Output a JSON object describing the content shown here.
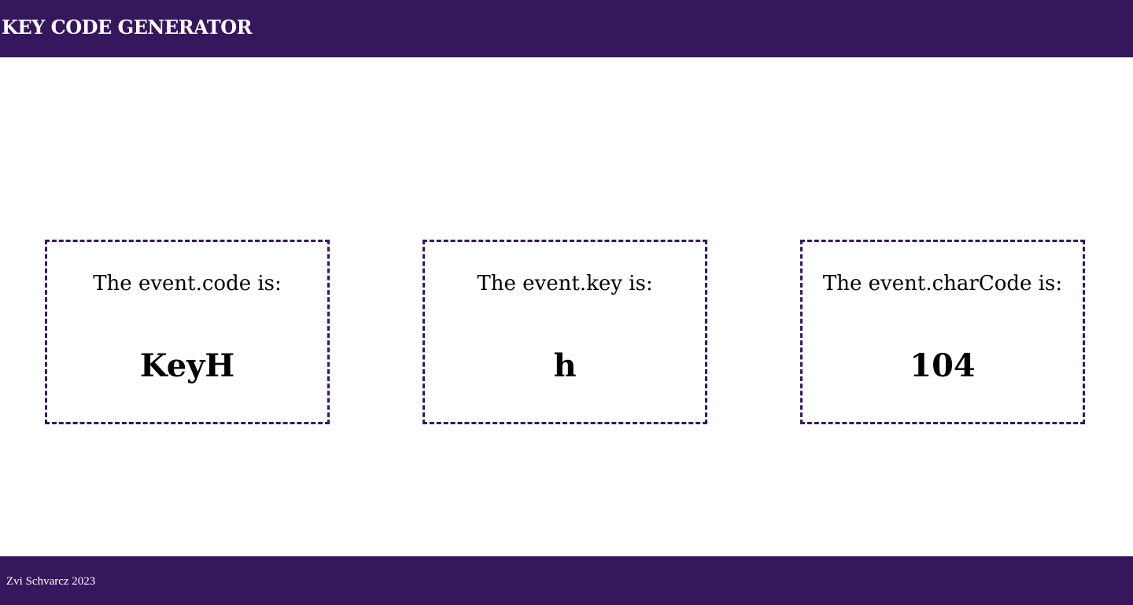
{
  "header": {
    "title": "KEY CODE GENERATOR"
  },
  "cards": [
    {
      "label": "The event.code is:",
      "value": "KeyH"
    },
    {
      "label": "The event.key is:",
      "value": "h"
    },
    {
      "label": "The event.charCode is:",
      "value": "104"
    }
  ],
  "footer": {
    "text": "Zvi Schvarcz 2023"
  },
  "colors": {
    "brand": "#36175e",
    "background": "#ffffff",
    "text": "#000000"
  }
}
